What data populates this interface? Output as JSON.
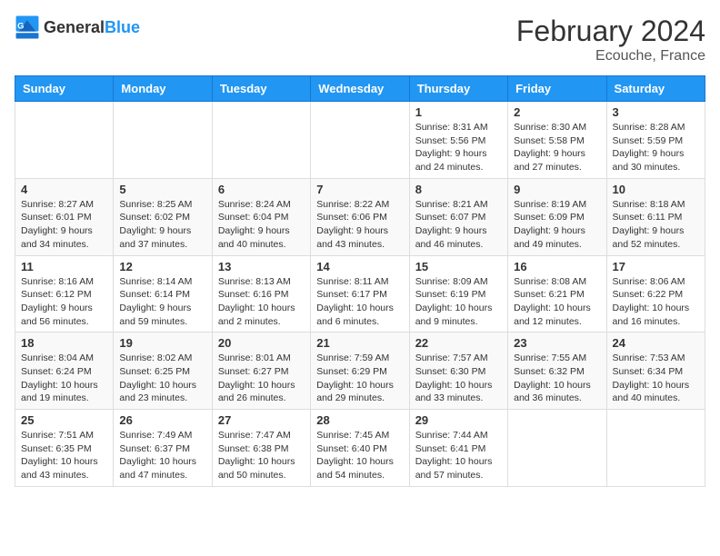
{
  "header": {
    "logo_general": "General",
    "logo_blue": "Blue",
    "title": "February 2024",
    "subtitle": "Ecouche, France"
  },
  "calendar": {
    "columns": [
      "Sunday",
      "Monday",
      "Tuesday",
      "Wednesday",
      "Thursday",
      "Friday",
      "Saturday"
    ],
    "rows": [
      [
        {
          "day": "",
          "info": ""
        },
        {
          "day": "",
          "info": ""
        },
        {
          "day": "",
          "info": ""
        },
        {
          "day": "",
          "info": ""
        },
        {
          "day": "1",
          "info": "Sunrise: 8:31 AM\nSunset: 5:56 PM\nDaylight: 9 hours and 24 minutes."
        },
        {
          "day": "2",
          "info": "Sunrise: 8:30 AM\nSunset: 5:58 PM\nDaylight: 9 hours and 27 minutes."
        },
        {
          "day": "3",
          "info": "Sunrise: 8:28 AM\nSunset: 5:59 PM\nDaylight: 9 hours and 30 minutes."
        }
      ],
      [
        {
          "day": "4",
          "info": "Sunrise: 8:27 AM\nSunset: 6:01 PM\nDaylight: 9 hours and 34 minutes."
        },
        {
          "day": "5",
          "info": "Sunrise: 8:25 AM\nSunset: 6:02 PM\nDaylight: 9 hours and 37 minutes."
        },
        {
          "day": "6",
          "info": "Sunrise: 8:24 AM\nSunset: 6:04 PM\nDaylight: 9 hours and 40 minutes."
        },
        {
          "day": "7",
          "info": "Sunrise: 8:22 AM\nSunset: 6:06 PM\nDaylight: 9 hours and 43 minutes."
        },
        {
          "day": "8",
          "info": "Sunrise: 8:21 AM\nSunset: 6:07 PM\nDaylight: 9 hours and 46 minutes."
        },
        {
          "day": "9",
          "info": "Sunrise: 8:19 AM\nSunset: 6:09 PM\nDaylight: 9 hours and 49 minutes."
        },
        {
          "day": "10",
          "info": "Sunrise: 8:18 AM\nSunset: 6:11 PM\nDaylight: 9 hours and 52 minutes."
        }
      ],
      [
        {
          "day": "11",
          "info": "Sunrise: 8:16 AM\nSunset: 6:12 PM\nDaylight: 9 hours and 56 minutes."
        },
        {
          "day": "12",
          "info": "Sunrise: 8:14 AM\nSunset: 6:14 PM\nDaylight: 9 hours and 59 minutes."
        },
        {
          "day": "13",
          "info": "Sunrise: 8:13 AM\nSunset: 6:16 PM\nDaylight: 10 hours and 2 minutes."
        },
        {
          "day": "14",
          "info": "Sunrise: 8:11 AM\nSunset: 6:17 PM\nDaylight: 10 hours and 6 minutes."
        },
        {
          "day": "15",
          "info": "Sunrise: 8:09 AM\nSunset: 6:19 PM\nDaylight: 10 hours and 9 minutes."
        },
        {
          "day": "16",
          "info": "Sunrise: 8:08 AM\nSunset: 6:21 PM\nDaylight: 10 hours and 12 minutes."
        },
        {
          "day": "17",
          "info": "Sunrise: 8:06 AM\nSunset: 6:22 PM\nDaylight: 10 hours and 16 minutes."
        }
      ],
      [
        {
          "day": "18",
          "info": "Sunrise: 8:04 AM\nSunset: 6:24 PM\nDaylight: 10 hours and 19 minutes."
        },
        {
          "day": "19",
          "info": "Sunrise: 8:02 AM\nSunset: 6:25 PM\nDaylight: 10 hours and 23 minutes."
        },
        {
          "day": "20",
          "info": "Sunrise: 8:01 AM\nSunset: 6:27 PM\nDaylight: 10 hours and 26 minutes."
        },
        {
          "day": "21",
          "info": "Sunrise: 7:59 AM\nSunset: 6:29 PM\nDaylight: 10 hours and 29 minutes."
        },
        {
          "day": "22",
          "info": "Sunrise: 7:57 AM\nSunset: 6:30 PM\nDaylight: 10 hours and 33 minutes."
        },
        {
          "day": "23",
          "info": "Sunrise: 7:55 AM\nSunset: 6:32 PM\nDaylight: 10 hours and 36 minutes."
        },
        {
          "day": "24",
          "info": "Sunrise: 7:53 AM\nSunset: 6:34 PM\nDaylight: 10 hours and 40 minutes."
        }
      ],
      [
        {
          "day": "25",
          "info": "Sunrise: 7:51 AM\nSunset: 6:35 PM\nDaylight: 10 hours and 43 minutes."
        },
        {
          "day": "26",
          "info": "Sunrise: 7:49 AM\nSunset: 6:37 PM\nDaylight: 10 hours and 47 minutes."
        },
        {
          "day": "27",
          "info": "Sunrise: 7:47 AM\nSunset: 6:38 PM\nDaylight: 10 hours and 50 minutes."
        },
        {
          "day": "28",
          "info": "Sunrise: 7:45 AM\nSunset: 6:40 PM\nDaylight: 10 hours and 54 minutes."
        },
        {
          "day": "29",
          "info": "Sunrise: 7:44 AM\nSunset: 6:41 PM\nDaylight: 10 hours and 57 minutes."
        },
        {
          "day": "",
          "info": ""
        },
        {
          "day": "",
          "info": ""
        }
      ]
    ]
  }
}
